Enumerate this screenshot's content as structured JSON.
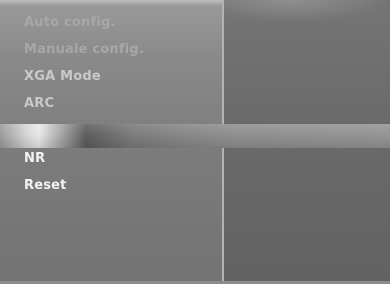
{
  "menu": {
    "items": [
      {
        "label": "Auto config."
      },
      {
        "label": "Manuale config."
      },
      {
        "label": "XGA Mode"
      },
      {
        "label": "ARC"
      },
      {
        "label": ""
      },
      {
        "label": "NR"
      },
      {
        "label": "Reset"
      }
    ]
  },
  "state": {
    "selected_index": 4
  }
}
